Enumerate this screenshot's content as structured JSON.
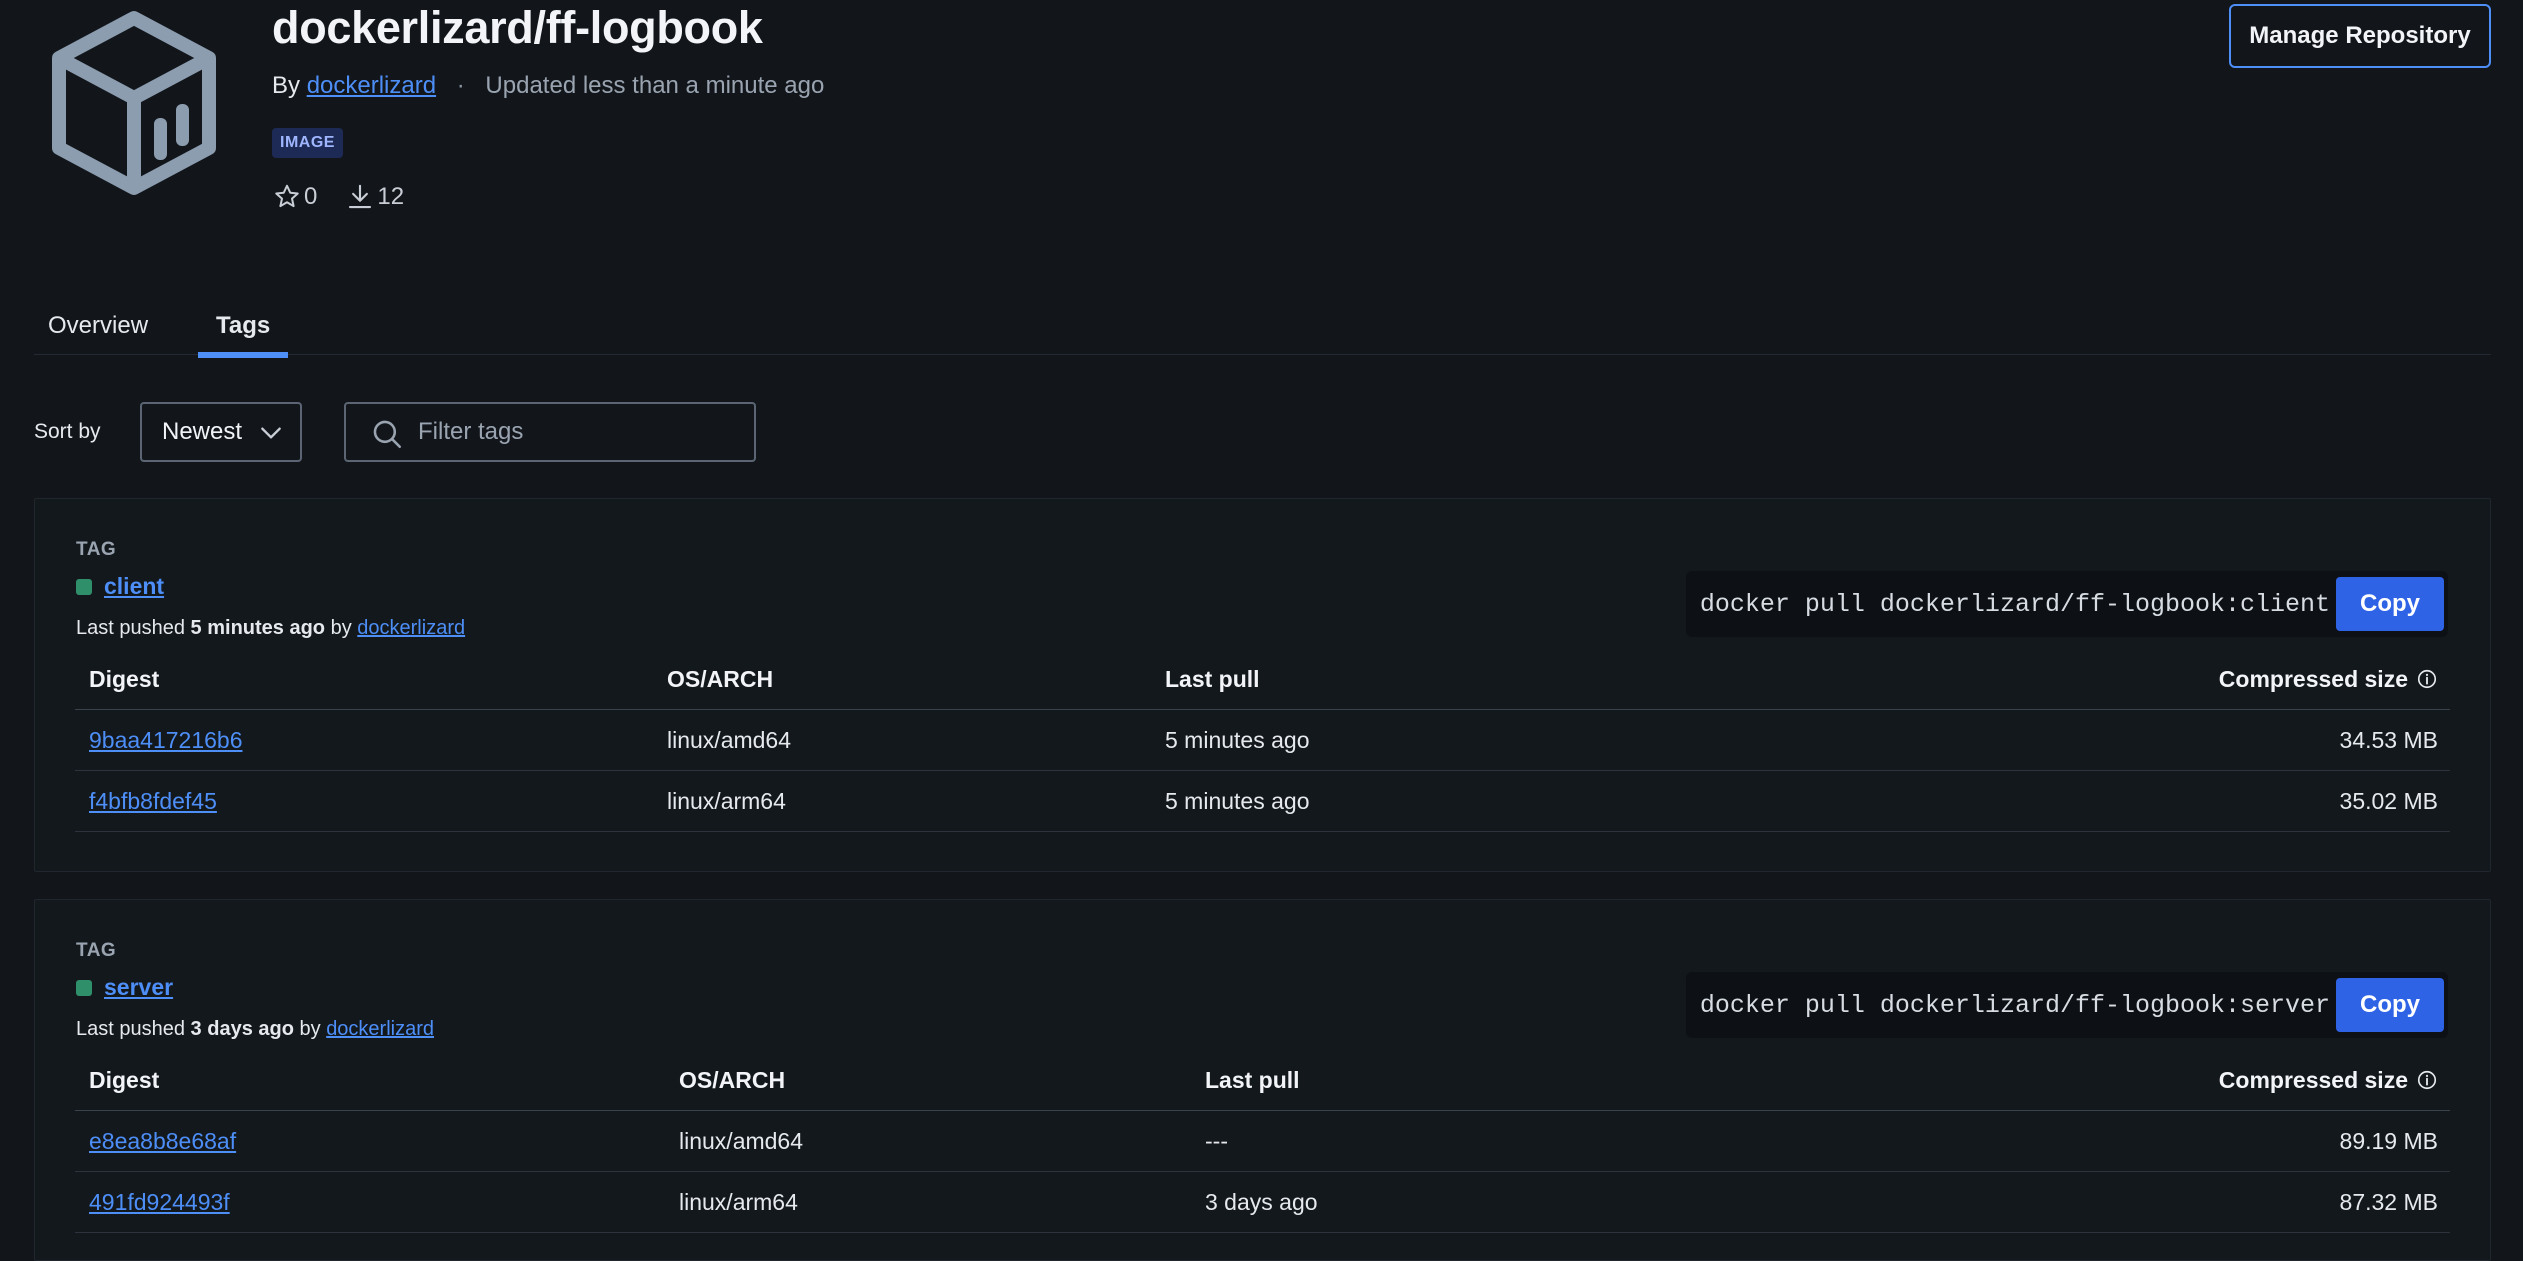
{
  "repo": {
    "name": "dockerlizard/ff-logbook",
    "by_prefix": "By",
    "owner": "dockerlizard",
    "separator": "·",
    "updated": "Updated less than a minute ago",
    "badge": "IMAGE",
    "stars": "0",
    "pulls": "12",
    "manage_label": "Manage Repository"
  },
  "tabs": [
    {
      "label": "Overview",
      "active": false
    },
    {
      "label": "Tags",
      "active": true
    }
  ],
  "toolbar": {
    "sort_label": "Sort by",
    "sort_value": "Newest",
    "filter_placeholder": "Filter tags"
  },
  "colors": {
    "accent": "#4d8ef7",
    "button": "#2f63e6",
    "tag_dot": "#2f8f6b",
    "background": "#12161b"
  },
  "tags": [
    {
      "kicker": "TAG",
      "name": "client",
      "pushed_prefix": "Last pushed",
      "pushed_when": "5 minutes ago",
      "pushed_by_word": "by",
      "pushed_by": "dockerlizard",
      "pull_command": "docker pull dockerlizard/ff-logbook:client",
      "copy_label": "Copy",
      "headers": {
        "digest": "Digest",
        "os": "OS/ARCH",
        "last_pull": "Last pull",
        "size": "Compressed size"
      },
      "rows": [
        {
          "digest": "9baa417216b6",
          "os": "linux/amd64",
          "last_pull": "5 minutes ago",
          "size": "34.53 MB"
        },
        {
          "digest": "f4bfb8fdef45",
          "os": "linux/arm64",
          "last_pull": "5 minutes ago",
          "size": "35.02 MB"
        }
      ]
    },
    {
      "kicker": "TAG",
      "name": "server",
      "pushed_prefix": "Last pushed",
      "pushed_when": "3 days ago",
      "pushed_by_word": "by",
      "pushed_by": "dockerlizard",
      "pull_command": "docker pull dockerlizard/ff-logbook:server",
      "copy_label": "Copy",
      "headers": {
        "digest": "Digest",
        "os": "OS/ARCH",
        "last_pull": "Last pull",
        "size": "Compressed size"
      },
      "rows": [
        {
          "digest": "e8ea8b8e68af",
          "os": "linux/amd64",
          "last_pull": "---",
          "size": "89.19 MB"
        },
        {
          "digest": "491fd924493f",
          "os": "linux/arm64",
          "last_pull": "3 days ago",
          "size": "87.32 MB"
        }
      ]
    }
  ]
}
